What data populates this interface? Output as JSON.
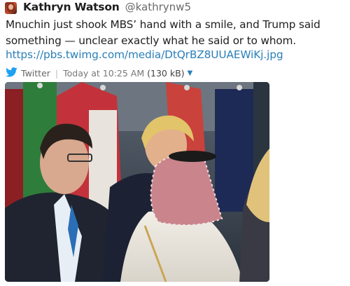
{
  "tweet": {
    "author_name": "Kathryn Watson",
    "author_handle": "@kathrynw5",
    "text": "Mnuchin just shook MBS’ hand with a smile, and Trump said something — unclear exactly what he said or to whom.",
    "link": "https://pbs.twimg.com/media/DtQrBZ8UUAEWiKj.jpg",
    "source": "Twitter",
    "timestamp": "Today at 10:25 AM",
    "file_size": "(130 kB)"
  },
  "icons": {
    "source_icon": "twitter-bird-icon",
    "expand_icon": "caret-down-icon"
  },
  "colors": {
    "link": "#2a7fb8",
    "twitter_blue": "#1da1f2",
    "muted": "#777777"
  }
}
